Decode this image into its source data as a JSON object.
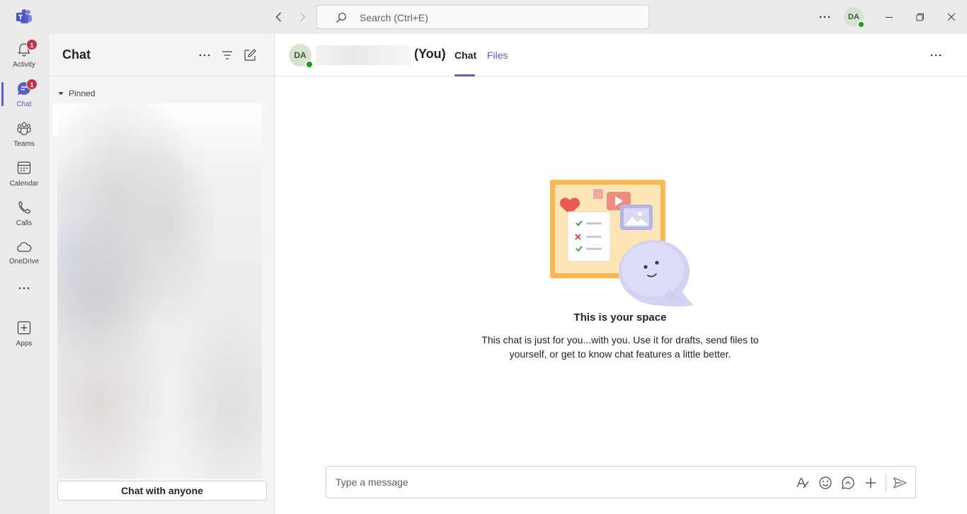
{
  "titlebar": {
    "search_placeholder": "Search (Ctrl+E)",
    "user_initials": "DA"
  },
  "rail": {
    "items": [
      {
        "label": "Activity",
        "badge": "1"
      },
      {
        "label": "Chat",
        "badge": "1"
      },
      {
        "label": "Teams"
      },
      {
        "label": "Calendar"
      },
      {
        "label": "Calls"
      },
      {
        "label": "OneDrive"
      },
      {
        "label": "Apps"
      }
    ]
  },
  "list": {
    "title": "Chat",
    "pinned_label": "Pinned",
    "chat_with_anyone": "Chat with anyone"
  },
  "main": {
    "avatar_initials": "DA",
    "you_label": "(You)",
    "tabs": [
      {
        "label": "Chat",
        "active": true
      },
      {
        "label": "Files",
        "active": false
      }
    ],
    "space_title": "This is your space",
    "space_desc": "This chat is just for you...with you. Use it for drafts, send files to yourself, or get to know chat features a little better.",
    "composer_placeholder": "Type a message"
  },
  "colors": {
    "accent": "#5b5fc7",
    "presence": "#13a10e",
    "badge": "#c4314b"
  }
}
